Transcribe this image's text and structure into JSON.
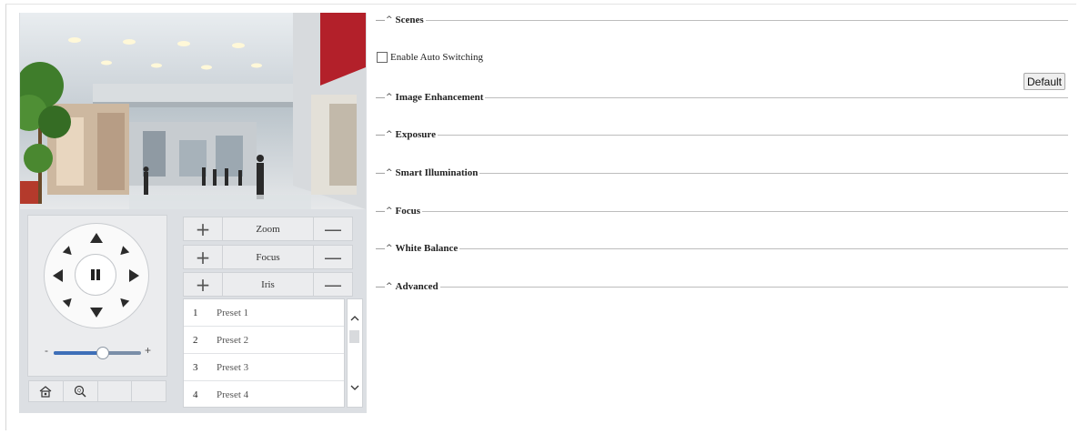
{
  "video": {
    "alt": "live-view-shopping-mall"
  },
  "ptz": {
    "directions": [
      "up",
      "up-right",
      "right",
      "down-right",
      "down",
      "down-left",
      "left",
      "up-left"
    ],
    "center": "pause-icon",
    "speed_slider": {
      "min_label": "-",
      "max_label": "+",
      "value": 0.55
    }
  },
  "toolbar": {
    "icons": [
      "home-position-icon",
      "zoom-area-icon",
      "blank-tool",
      "blank-tool"
    ]
  },
  "controls": [
    {
      "plus": "+",
      "label": "Zoom",
      "minus": "—"
    },
    {
      "plus": "+",
      "label": "Focus",
      "minus": "—"
    },
    {
      "plus": "+",
      "label": "Iris",
      "minus": "—"
    }
  ],
  "presets": [
    {
      "num": "1",
      "name": "Preset 1"
    },
    {
      "num": "2",
      "name": "Preset 2"
    },
    {
      "num": "3",
      "name": "Preset 3"
    },
    {
      "num": "4",
      "name": "Preset 4"
    }
  ],
  "scrollbar": {
    "up": "^",
    "down": "v"
  },
  "sections": {
    "scenes": "Scenes",
    "image_enhancement": "Image Enhancement",
    "exposure": "Exposure",
    "smart_illumination": "Smart Illumination",
    "focus": "Focus",
    "white_balance": "White Balance",
    "advanced": "Advanced"
  },
  "section_prefix": {
    "dash": "—",
    "toggle": "^"
  },
  "scenes": {
    "auto_switch_label": "Enable Auto Switching",
    "auto_switch_checked": false
  },
  "default_button": "Default",
  "colors": {
    "panel_bg": "#dcdfe3",
    "control_bg": "#ebecee",
    "slider_fill": "#3e6fb8"
  }
}
